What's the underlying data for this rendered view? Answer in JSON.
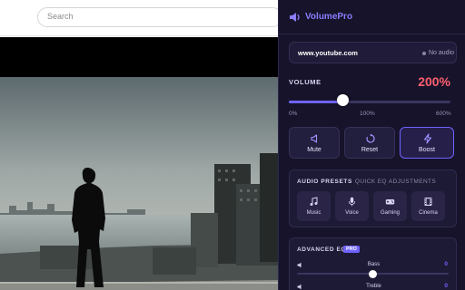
{
  "browser": {
    "search_placeholder": "Search"
  },
  "popup": {
    "app_title": "VolumePro",
    "site": {
      "domain": "www.youtube.com",
      "status": "No audio"
    },
    "volume": {
      "label": "VOLUME",
      "value_text": "200%",
      "level_fraction": 0.333,
      "ticks": [
        "0%",
        "100%",
        "600%"
      ]
    },
    "buttons": [
      {
        "label": "Mute",
        "icon": "speaker-mute-icon"
      },
      {
        "label": "Reset",
        "icon": "reset-icon"
      },
      {
        "label": "Boost",
        "icon": "lightning-icon"
      }
    ],
    "presets": {
      "title": "AUDIO PRESETS",
      "subtitle": "QUICK EQ ADJUSTMENTS",
      "items": [
        {
          "label": "Music",
          "icon": "music-note-icon"
        },
        {
          "label": "Voice",
          "icon": "microphone-icon"
        },
        {
          "label": "Gaming",
          "icon": "gamepad-icon"
        },
        {
          "label": "Cinema",
          "icon": "film-icon"
        }
      ]
    },
    "eq": {
      "title": "ADVANCED EQ",
      "badge": "PRO",
      "bands": [
        {
          "label": "Bass",
          "value": "0",
          "level_fraction": 0.5
        },
        {
          "label": "Treble",
          "value": "0",
          "level_fraction": 0.5
        }
      ]
    },
    "colors": {
      "accent": "#6f63ff",
      "volume_value": "#ff5f6d",
      "background": "#16132a"
    }
  }
}
